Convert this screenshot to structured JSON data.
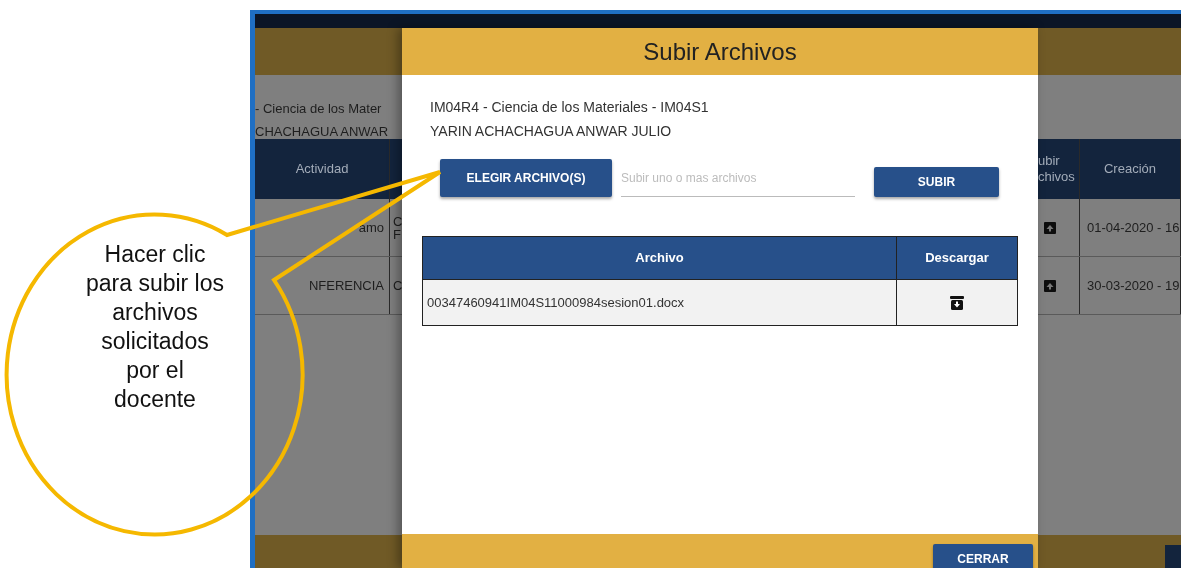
{
  "background_page": {
    "course": "- Ciencia de los Mater",
    "student": "CHACHAGUA ANWAR",
    "columns": [
      "Actividad",
      "ubir\nchivos",
      "Creación"
    ],
    "rows": [
      {
        "activity": "amo",
        "column_2": [
          "C",
          "F"
        ],
        "date": "01-04-2020 - 16"
      },
      {
        "activity": "NFERENCIA",
        "column_2": [
          "C"
        ],
        "date": "30-03-2020 - 19"
      }
    ]
  },
  "modal": {
    "title": "Subir Archivos",
    "course": "IM04R4 - Ciencia de los Materiales - IM04S1",
    "student": "YARIN ACHACHAGUA ANWAR JULIO",
    "choose_button": "ELEGIR ARCHIVO(S)",
    "file_field": {
      "placeholder": "Subir uno o mas archivos"
    },
    "upload_button": "SUBIR",
    "files_table": {
      "columns": [
        "Archivo",
        "Descargar"
      ],
      "rows": [
        {
          "name": "00347460941IM04S11000984sesion01.docx"
        }
      ]
    },
    "close_button": "CERRAR"
  },
  "callout": {
    "lines": [
      "Hacer clic",
      "para subir los",
      "archivos",
      "solicitados",
      "por el",
      "docente"
    ]
  }
}
